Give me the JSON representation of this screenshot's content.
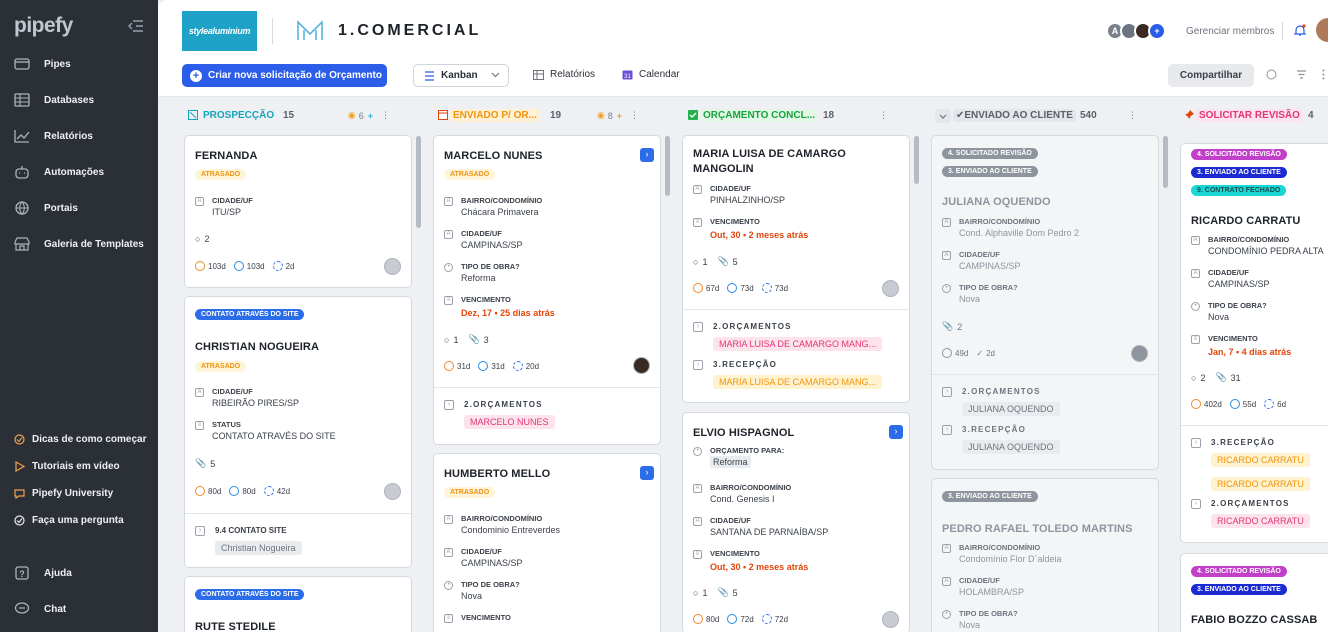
{
  "sidebar": {
    "logo": "pipefy",
    "items": [
      {
        "label": "Pipes",
        "icon": "folder-icon"
      },
      {
        "label": "Databases",
        "icon": "table-icon"
      },
      {
        "label": "Relatórios",
        "icon": "chart-icon"
      },
      {
        "label": "Automações",
        "icon": "robot-icon"
      },
      {
        "label": "Portais",
        "icon": "globe-icon"
      },
      {
        "label": "Galeria de Templates",
        "icon": "store-icon"
      }
    ],
    "help_items": [
      {
        "label": "Dicas de como começar"
      },
      {
        "label": "Tutoriais em vídeo"
      },
      {
        "label": "Pipefy University"
      },
      {
        "label": "Faça uma pergunta"
      }
    ],
    "bottom": [
      {
        "label": "Ajuda"
      },
      {
        "label": "Chat"
      }
    ]
  },
  "header": {
    "company_logo_text": "stylealuminium",
    "pipe_title": "1.COMERCIAL",
    "avatar_letter": "A",
    "members_link": "Gerenciar membros",
    "new_request": "Criar nova solicitação de Orçamento",
    "view": "Kanban",
    "reports": "Relatórios",
    "calendar": "Calendar",
    "share": "Compartilhar"
  },
  "columns": [
    {
      "title": "PROSPECÇÃO",
      "count": "15",
      "wip": "6",
      "color": "#15a5b8",
      "bg": "#e3f5f7"
    },
    {
      "title": "ENVIADO P/ OR...",
      "count": "19",
      "wip": "8",
      "color": "#f0950f",
      "bg": "#fff1d6"
    },
    {
      "title": "ORÇAMENTO CONCL...",
      "count": "18",
      "color": "#15a53c",
      "bg": "#e3f7e6"
    },
    {
      "title": "✔ENVIADO AO CLIENTE",
      "count": "540",
      "color": "#5a616b",
      "bg": "#e3e6ea"
    },
    {
      "title": "SOLICITAR REVISÃO",
      "count": "4",
      "color": "#e0357a",
      "bg": "#fde4ec"
    }
  ],
  "cards": {
    "c1": {
      "title": "FERNANDA",
      "tag": "ATRASADO",
      "f1_label": "CIDADE/UF",
      "f1_value": "ITU/SP",
      "comments": "2",
      "t1": "103d",
      "t2": "103d",
      "t3": "2d"
    },
    "c2": {
      "tag0": "CONTATO ATRAVÉS DO SITE",
      "title": "CHRISTIAN NOGUEIRA",
      "tag": "ATRASADO",
      "f1_label": "CIDADE/UF",
      "f1_value": "RIBEIRÃO PIRES/SP",
      "f2_label": "STATUS",
      "f2_value": "CONTATO ATRAVÉS DO SITE",
      "attach": "5",
      "t1": "80d",
      "t2": "80d",
      "t3": "42d",
      "conn_label": "9.4 CONTATO SITE",
      "conn_chip": "Christian Nogueira"
    },
    "c3": {
      "tag0": "CONTATO ATRAVÉS DO SITE",
      "title": "RUTE STEDILE"
    },
    "c4": {
      "title": "MARCELO NUNES",
      "tag": "ATRASADO",
      "f1_label": "BAIRRO/CONDOMÍNIO",
      "f1_value": "Chácara Primavera",
      "f2_label": "CIDADE/UF",
      "f2_value": "CAMPINAS/SP",
      "f3_label": "TIPO DE OBRA?",
      "f3_value": "Reforma",
      "f4_label": "VENCIMENTO",
      "f4_value": "Dez, 17 • 25 dias atrás",
      "comments": "1",
      "attach": "3",
      "t1": "31d",
      "t2": "31d",
      "t3": "20d",
      "conn_label": "2.ORÇAMENTOS",
      "conn_chip": "MARCELO NUNES"
    },
    "c5": {
      "title": "HUMBERTO MELLO",
      "tag": "ATRASADO",
      "f1_label": "BAIRRO/CONDOMÍNIO",
      "f1_value": "Condominio Entreverdes",
      "f2_label": "CIDADE/UF",
      "f2_value": "CAMPINAS/SP",
      "f3_label": "TIPO DE OBRA?",
      "f3_value": "Nova",
      "f4_label": "VENCIMENTO"
    },
    "c6": {
      "title1": "MARIA LUISA DE CAMARGO",
      "title2": "MANGOLIN",
      "f1_label": "CIDADE/UF",
      "f1_value": "PINHALZINHO/SP",
      "f2_label": "VENCIMENTO",
      "f2_value": "Out, 30 • 2 meses atrás",
      "comments": "1",
      "attach": "5",
      "t1": "67d",
      "t2": "73d",
      "t3": "73d",
      "conn1_label": "2.ORÇAMENTOS",
      "conn1_chip": "MARIA LUISA DE CAMARGO MANG...",
      "conn2_label": "3.RECEPÇÃO",
      "conn2_chip": "MARIA LUISA DE CAMARGO MANG..."
    },
    "c7": {
      "title": "ELVIO HISPAGNOL",
      "f1_label": "ORÇAMENTO PARA:",
      "f1_value": "Reforma",
      "f2_label": "BAIRRO/CONDOMÍNIO",
      "f2_value": "Cond. Genesis I",
      "f3_label": "CIDADE/UF",
      "f3_value": "SANTANA DE PARNAÍBA/SP",
      "f4_label": "VENCIMENTO",
      "f4_value": "Out, 30 • 2 meses atrás",
      "comments": "1",
      "attach": "5",
      "t1": "80d",
      "t2": "72d",
      "t3": "72d"
    },
    "c8": {
      "tag_a": "4. SOLICITADO REVISÃO",
      "tag_b": "3. ENVIADO AO CLIENTE",
      "title": "JULIANA OQUENDO",
      "f1_label": "BAIRRO/CONDOMÍNIO",
      "f1_value": "Cond. Alphaville Dom Pedro 2",
      "f2_label": "CIDADE/UF",
      "f2_value": "CAMPINAS/SP",
      "f3_label": "TIPO DE OBRA?",
      "f3_value": "Nova",
      "attach": "2",
      "t1": "49d",
      "t2": "2d",
      "conn1_label": "2.ORÇAMENTOS",
      "conn1_chip": "JULIANA OQUENDO",
      "conn2_label": "3.RECEPÇÃO",
      "conn2_chip": "JULIANA OQUENDO"
    },
    "c9": {
      "tag_a": "3. ENVIADO AO CLIENTE",
      "title": "PEDRO RAFAEL TOLEDO MARTINS",
      "f1_label": "BAIRRO/CONDOMÍNIO",
      "f1_value": "Condomínio Flor D´aldeia",
      "f2_label": "CIDADE/UF",
      "f2_value": "HOLAMBRA/SP",
      "f3_label": "TIPO DE OBRA?",
      "f3_value": "Nova"
    },
    "c10": {
      "tag_a": "4. SOLICITADO REVISÃO",
      "tag_b": "3. ENVIADO AO CLIENTE",
      "tag_c": "9. CONTRATO FECHADO",
      "title": "RICARDO CARRATU",
      "f1_label": "BAIRRO/CONDOMÍNIO",
      "f1_value": "CONDOMÍNIO PEDRA ALTA",
      "f2_label": "CIDADE/UF",
      "f2_value": "CAMPINAS/SP",
      "f3_label": "TIPO DE OBRA?",
      "f3_value": "Nova",
      "f4_label": "VENCIMENTO",
      "f4_value": "Jan, 7 • 4 dias atrás",
      "comments": "2",
      "attach": "31",
      "t1": "402d",
      "t2": "55d",
      "t3": "6d",
      "conn1_label": "3.RECEPÇÃO",
      "conn1_chip": "RICARDO CARRATU",
      "conn1_chip2": "RICARDO CARRATU",
      "conn2_label": "2.ORÇAMENTOS",
      "conn2_chip": "RICARDO CARRATU"
    },
    "c11": {
      "tag_a": "4. SOLICITADO REVISÃO",
      "tag_b": "3. ENVIADO AO CLIENTE",
      "title": "FABIO BOZZO CASSAB"
    }
  }
}
